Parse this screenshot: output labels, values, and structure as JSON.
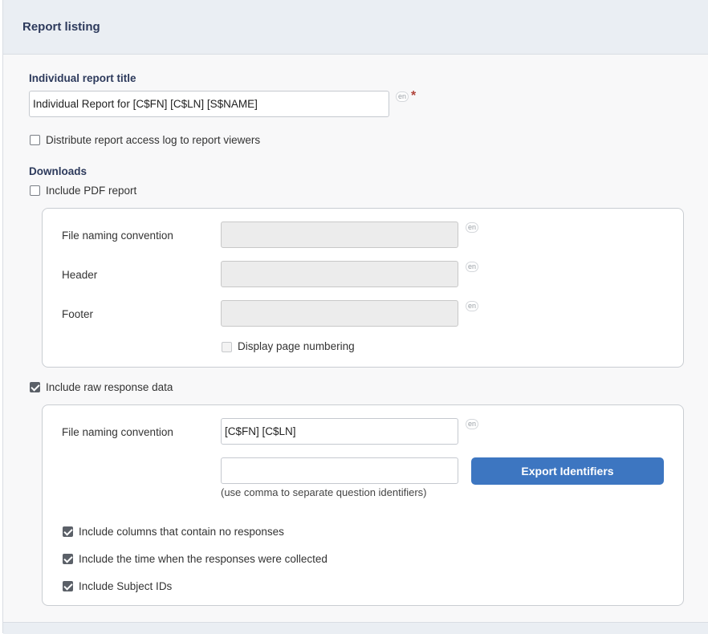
{
  "header": {
    "title": "Report listing"
  },
  "report_title": {
    "label": "Individual report title",
    "value": "Individual Report for [C$FN] [C$LN] [S$NAME]",
    "lang": "en",
    "required_marker": "*"
  },
  "distribute_log": {
    "label": "Distribute report access log to report viewers",
    "checked": false
  },
  "downloads": {
    "heading": "Downloads",
    "pdf": {
      "label": "Include PDF report",
      "checked": false,
      "file_naming_label": "File naming convention",
      "header_label": "Header",
      "footer_label": "Footer",
      "lang": "en",
      "page_numbering_label": "Display page numbering"
    },
    "raw": {
      "label": "Include raw response data",
      "checked": true,
      "file_naming_label": "File naming convention",
      "file_naming_value": "[C$FN] [C$LN]",
      "lang": "en",
      "identifiers_value": "",
      "identifiers_hint": "(use comma to separate question identifiers)",
      "export_button": "Export Identifiers",
      "options": [
        {
          "label": "Include columns that contain no responses",
          "checked": true
        },
        {
          "label": "Include the time when the responses were collected",
          "checked": true
        },
        {
          "label": "Include Subject IDs",
          "checked": true
        }
      ]
    }
  },
  "colors": {
    "accent": "#3d76c1",
    "heading": "#2d3a5c",
    "required": "#b0433a"
  }
}
